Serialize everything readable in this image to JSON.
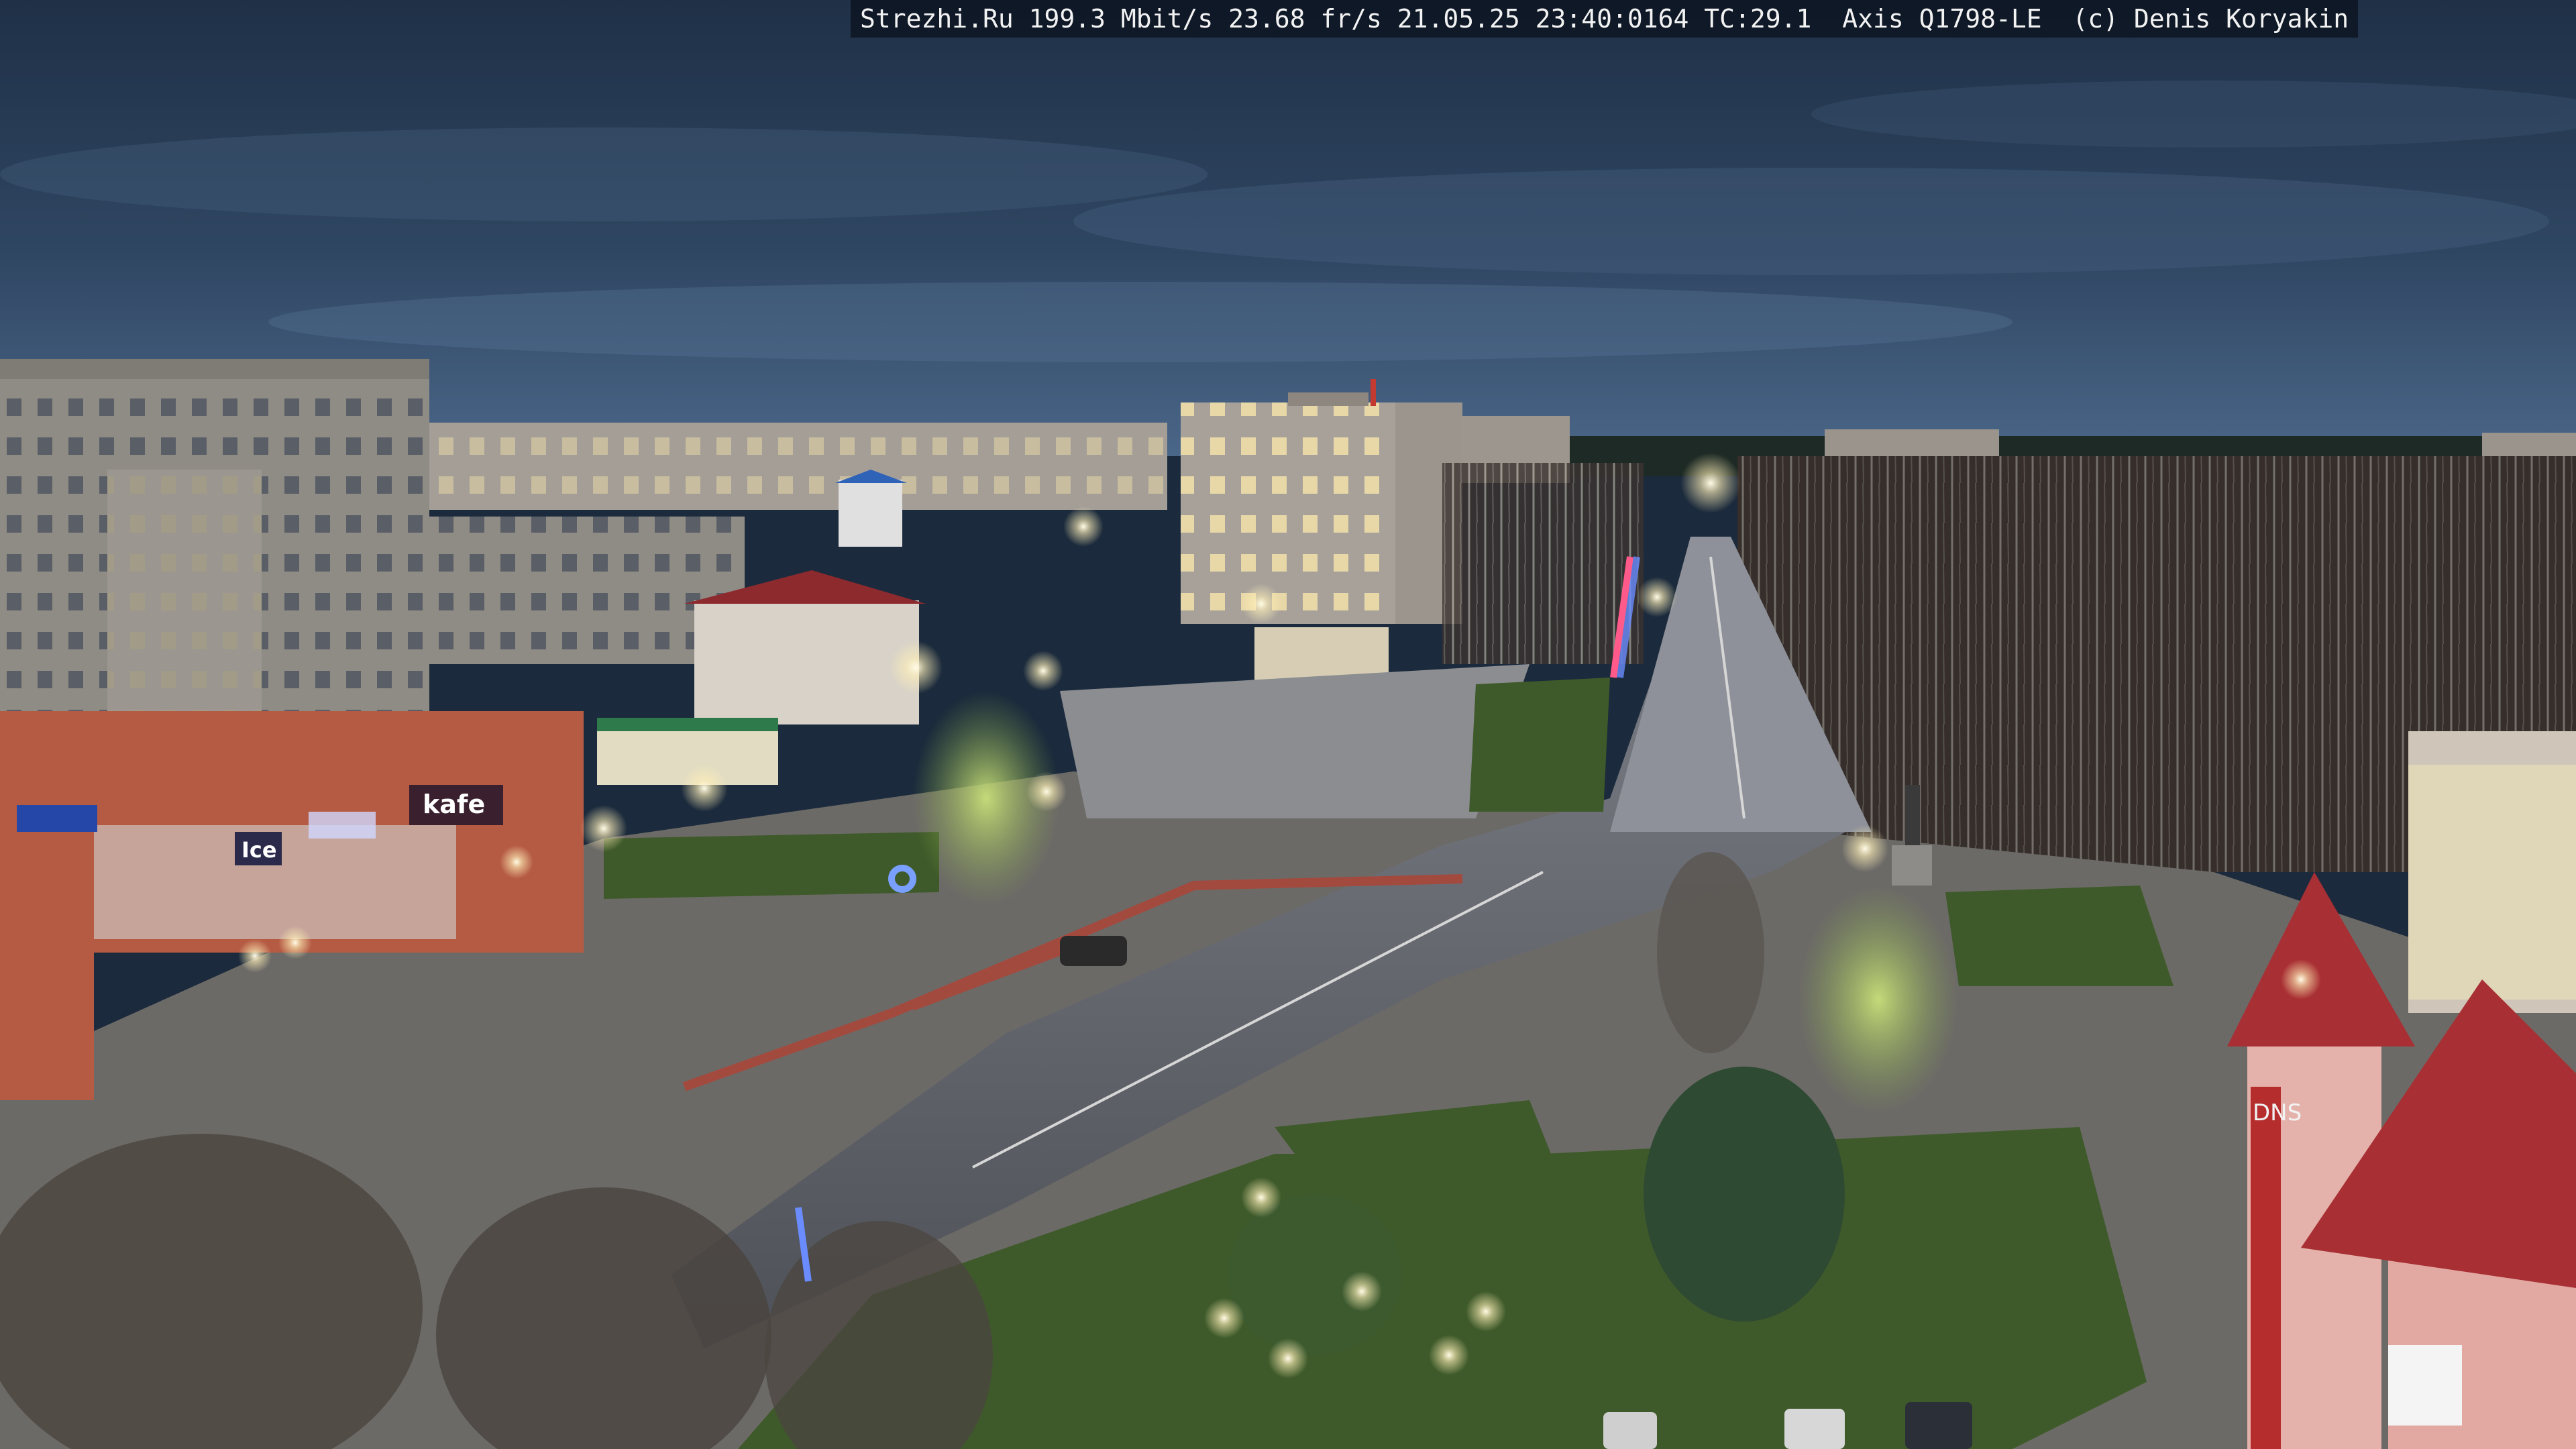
{
  "overlay": {
    "text": "Strezhi.Ru 199.3 Mbit/s 23.68 fr/s 21.05.25 23:40:0164 TC:29.1  Axis Q1798-LE  (c) Denis Koryakin"
  },
  "signs": {
    "cafe": "kafe",
    "ice": "Ice",
    "dns": "DNS"
  },
  "colors": {
    "sky_top": "#22344e",
    "sky_bottom": "#3a5473",
    "road": "#5d6168",
    "grass": "#3f5a2a",
    "roof_red": "#a82f33"
  }
}
